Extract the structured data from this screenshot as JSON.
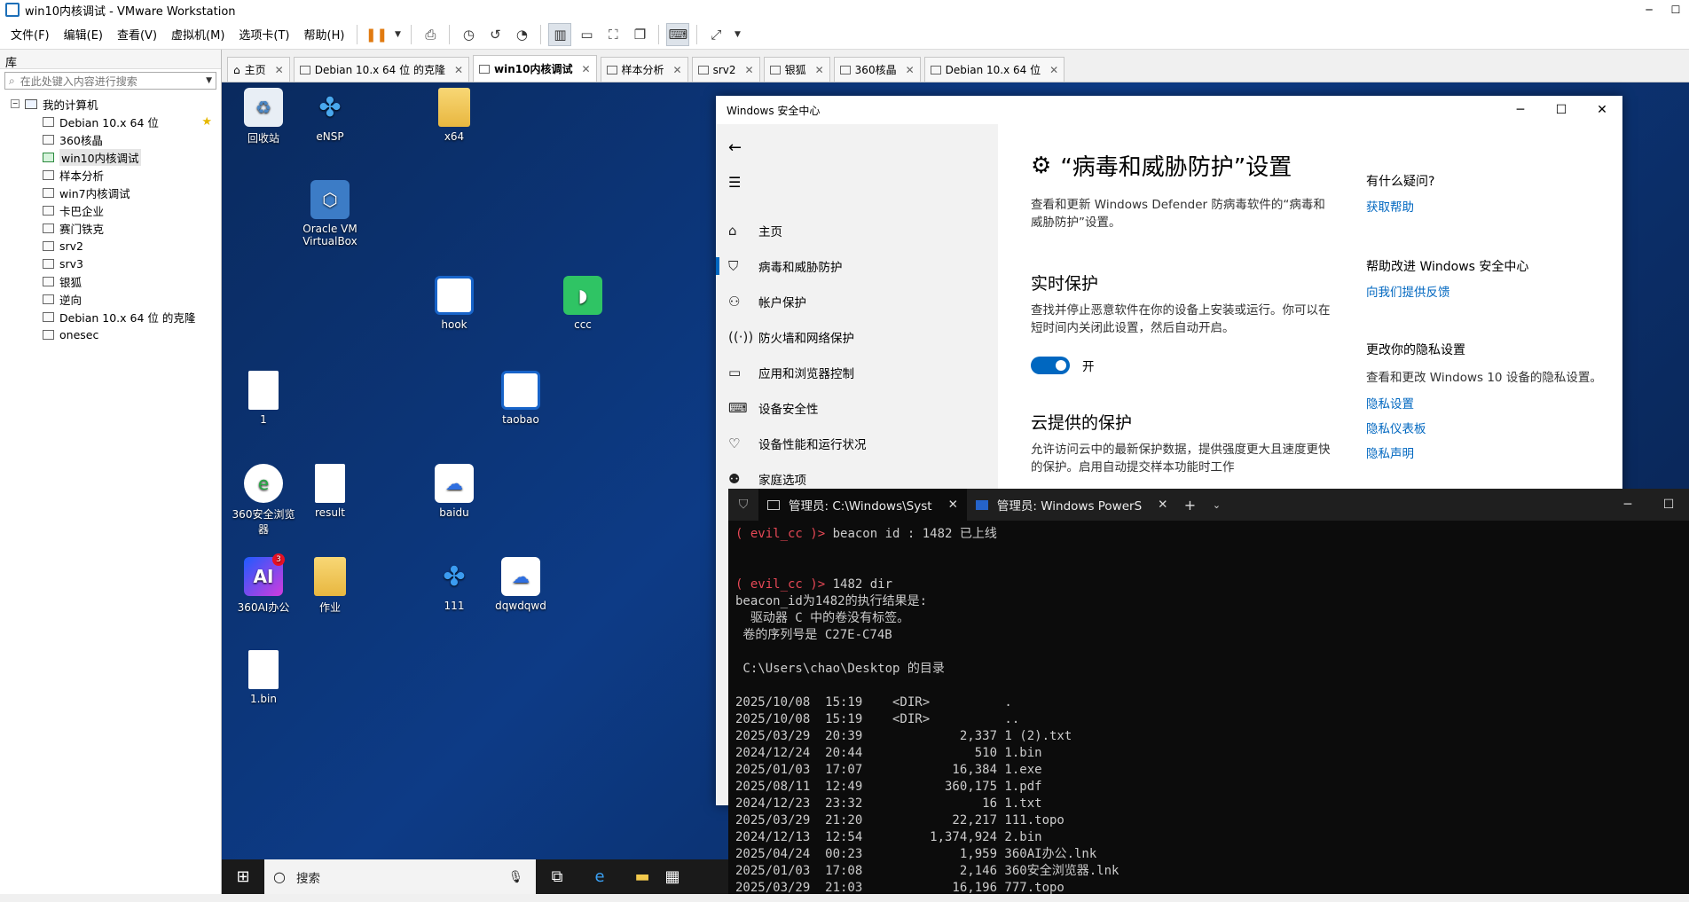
{
  "window": {
    "title": "win10内核调试 - VMware Workstation"
  },
  "menu": [
    "文件(F)",
    "编辑(E)",
    "查看(V)",
    "虚拟机(M)",
    "选项卡(T)",
    "帮助(H)"
  ],
  "library": {
    "header": "库",
    "search_placeholder": "在此处键入内容进行搜索",
    "root": "我的计算机",
    "items": [
      "Debian 10.x 64 位",
      "360核晶",
      "win10内核调试",
      "样本分析",
      "win7内核调试",
      "卡巴企业",
      "赛门铁克",
      "srv2",
      "srv3",
      "银狐",
      "逆向",
      "Debian 10.x 64 位 的克隆",
      "onesec"
    ]
  },
  "tabs": [
    "主页",
    "Debian 10.x 64 位 的克隆",
    "win10内核调试",
    "样本分析",
    "srv2",
    "银狐",
    "360核晶",
    "Debian 10.x 64 位"
  ],
  "desktop": {
    "icons": [
      "回收站",
      "eNSP",
      "x64",
      "Oracle VM VirtualBox",
      "hook",
      "ccc",
      "1",
      "taobao",
      "360安全浏览器",
      "result",
      "baidu",
      "360AI办公",
      "作业",
      "111",
      "dqwdqwd",
      "1.bin"
    ],
    "ai_badge": "3"
  },
  "security": {
    "title": "Windows 安全中心",
    "nav": [
      "主页",
      "病毒和威胁防护",
      "帐户保护",
      "防火墙和网络保护",
      "应用和浏览器控制",
      "设备安全性",
      "设备性能和运行状况",
      "家庭选项"
    ],
    "heading": "“病毒和威胁防护”设置",
    "heading_desc": "查看和更新 Windows Defender 防病毒软件的“病毒和威胁防护”设置。",
    "realtime_title": "实时保护",
    "realtime_desc": "查找并停止恶意软件在你的设备上安装或运行。你可以在短时间内关闭此设置，然后自动开启。",
    "toggle_label": "开",
    "cloud_title": "云提供的保护",
    "cloud_desc": "允许访问云中的最新保护数据，提供强度更大且速度更快的保护。启用自动提交样本功能时工作",
    "side": {
      "q_title": "有什么疑问?",
      "q_link": "获取帮助",
      "improve_title": "帮助改进 Windows 安全中心",
      "improve_link": "向我们提供反馈",
      "privacy_title": "更改你的隐私设置",
      "privacy_desc": "查看和更改 Windows 10 设备的隐私设置。",
      "privacy_links": [
        "隐私设置",
        "隐私仪表板",
        "隐私声明"
      ]
    }
  },
  "terminal": {
    "tab1": "管理员: C:\\Windows\\Syst",
    "tab2": "管理员: Windows PowerS",
    "lines": [
      {
        "prompt": "( evil_cc )>",
        "text": " beacon id : 1482 已上线"
      },
      {
        "prompt": "",
        "text": ""
      },
      {
        "prompt": "",
        "text": ""
      },
      {
        "prompt": "( evil_cc )>",
        "text": " 1482 dir"
      },
      {
        "prompt": "",
        "text": "beacon_id为1482的执行结果是:"
      },
      {
        "prompt": "",
        "text": "  驱动器 C 中的卷没有标签。"
      },
      {
        "prompt": "",
        "text": " 卷的序列号是 C27E-C74B"
      },
      {
        "prompt": "",
        "text": ""
      },
      {
        "prompt": "",
        "text": " C:\\Users\\chao\\Desktop 的目录"
      },
      {
        "prompt": "",
        "text": ""
      },
      {
        "prompt": "",
        "text": "2025/10/08  15:19    <DIR>          ."
      },
      {
        "prompt": "",
        "text": "2025/10/08  15:19    <DIR>          .."
      },
      {
        "prompt": "",
        "text": "2025/03/29  20:39             2,337 1 (2).txt"
      },
      {
        "prompt": "",
        "text": "2024/12/24  20:44               510 1.bin"
      },
      {
        "prompt": "",
        "text": "2025/01/03  17:07            16,384 1.exe"
      },
      {
        "prompt": "",
        "text": "2025/08/11  12:49           360,175 1.pdf"
      },
      {
        "prompt": "",
        "text": "2024/12/23  23:32                16 1.txt"
      },
      {
        "prompt": "",
        "text": "2025/03/29  21:20            22,217 111.topo"
      },
      {
        "prompt": "",
        "text": "2024/12/13  12:54         1,374,924 2.bin"
      },
      {
        "prompt": "",
        "text": "2025/04/24  00:23             1,959 360AI办公.lnk"
      },
      {
        "prompt": "",
        "text": "2025/01/03  17:08             2,146 360安全浏览器.lnk"
      },
      {
        "prompt": "",
        "text": "2025/03/29  21:03            16,196 777.topo"
      }
    ]
  },
  "taskbar": {
    "search_placeholder": "搜索"
  }
}
